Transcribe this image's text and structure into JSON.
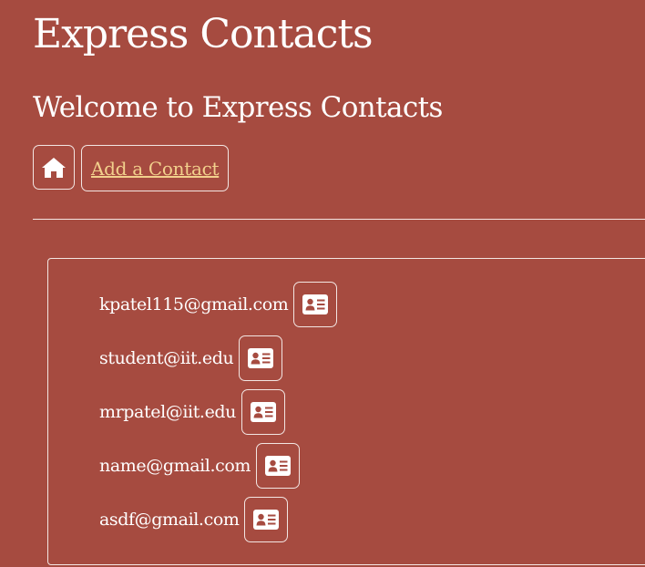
{
  "app": {
    "title": "Express Contacts"
  },
  "welcome": {
    "heading": "Welcome to Express Contacts"
  },
  "nav": {
    "home_icon": "home-icon",
    "add_contact_label": "Add a Contact"
  },
  "contacts": [
    {
      "email": "kpatel115@gmail.com",
      "icon": "contact-card-icon"
    },
    {
      "email": "student@iit.edu",
      "icon": "contact-card-icon"
    },
    {
      "email": "mrpatel@iit.edu",
      "icon": "contact-card-icon"
    },
    {
      "email": "name@gmail.com",
      "icon": "contact-card-icon"
    },
    {
      "email": "asdf@gmail.com",
      "icon": "contact-card-icon"
    }
  ],
  "colors": {
    "background": "#a64b40",
    "text": "#ffffff",
    "link": "#f2d08c",
    "border": "#f3e6e3"
  }
}
